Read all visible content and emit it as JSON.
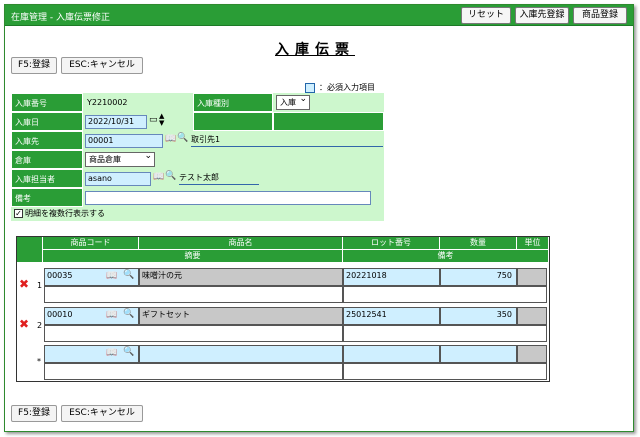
{
  "window": {
    "title": "在庫管理 - 入庫伝票修正",
    "buttons": {
      "reset": "リセット",
      "supplier_register": "入庫先登録",
      "product_register": "商品登録"
    }
  },
  "page_title": "入庫伝票",
  "actions": {
    "save": "F5:登録",
    "cancel": "ESC:キャンセル"
  },
  "legend_required": "：必須入力項目",
  "form": {
    "voucher_no_label": "入庫番号",
    "voucher_no": "Y2210002",
    "kind_label": "入庫種別",
    "kind": "入庫",
    "date_label": "入庫日",
    "date": "2022/10/31",
    "supplier_label": "入庫先",
    "supplier_code": "00001",
    "supplier_name": "取引先1",
    "warehouse_label": "倉庫",
    "warehouse": "商品倉庫",
    "staff_label": "入庫担当者",
    "staff_code": "asano",
    "staff_name": "テスト太郎",
    "memo_label": "備考",
    "memo": "",
    "multirow_label": "明細を複数行表示する",
    "multirow_checked": true
  },
  "grid": {
    "headers": {
      "product_code": "商品コード",
      "product_name": "商品名",
      "lot_no": "ロット番号",
      "qty": "数量",
      "unit": "単位",
      "summary": "摘要",
      "remarks": "備考"
    },
    "rows": [
      {
        "no": "1",
        "code": "00035",
        "name": "味噌汁の元",
        "lot": "20221018",
        "qty": "750",
        "unit": ""
      },
      {
        "no": "2",
        "code": "00010",
        "name": "ギフトセット",
        "lot": "25012541",
        "qty": "350",
        "unit": ""
      },
      {
        "no": "*",
        "code": "",
        "name": "",
        "lot": "",
        "qty": "",
        "unit": ""
      }
    ]
  },
  "colors": {
    "header_green": "#2a9d36",
    "field_green": "#cdf7cd",
    "required_blue": "#cfefff",
    "delete_red": "#e02020"
  }
}
